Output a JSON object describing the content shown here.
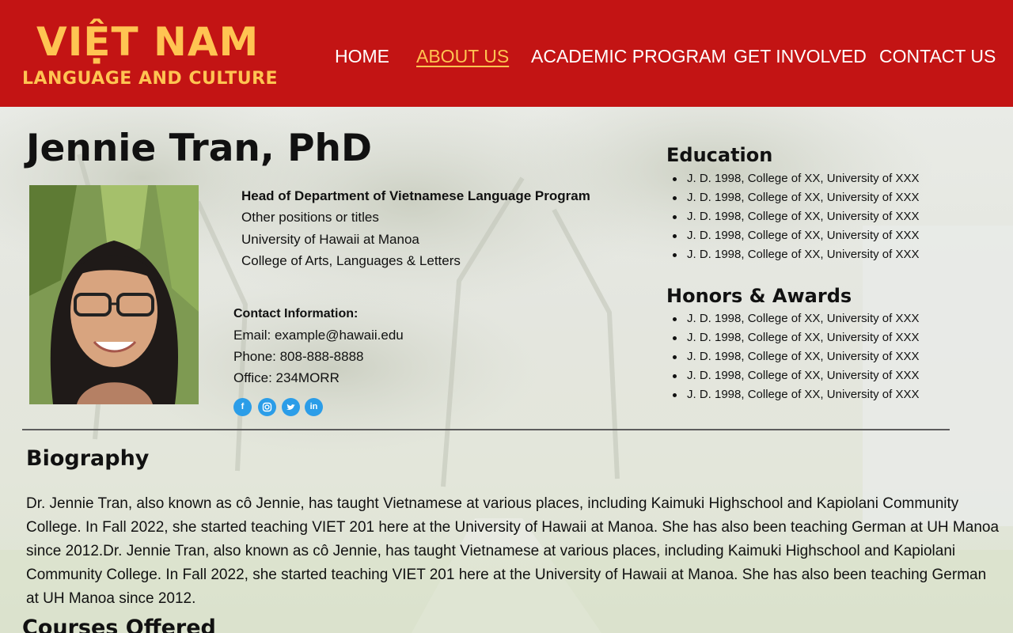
{
  "header": {
    "logo_title": "VIỆT NAM",
    "logo_subtitle": "LANGUAGE AND CULTURE",
    "brand_color": "#c31414",
    "accent_color": "#ffc452",
    "nav": [
      {
        "label": "HOME",
        "active": false
      },
      {
        "label": "ABOUT US",
        "active": true
      },
      {
        "label": "ACADEMIC PROGRAM",
        "active": false
      },
      {
        "label": "GET INVOLVED",
        "active": false
      },
      {
        "label": "CONTACT US",
        "active": false
      }
    ]
  },
  "profile": {
    "name": "Jennie Tran, PhD",
    "roles": [
      "Head of Department of Vietnamese Language Program",
      "Other positions or titles",
      "University of Hawaii at Manoa",
      "College of Arts, Languages & Letters"
    ],
    "contact": {
      "heading": "Contact Information:",
      "email": "Email: example@hawaii.edu",
      "phone": "Phone: 808-888-8888",
      "office": "Office: 234MORR"
    },
    "social_icons": [
      "facebook-icon",
      "instagram-icon",
      "twitter-icon",
      "linkedin-icon"
    ]
  },
  "education": {
    "title": "Education",
    "items": [
      "J. D. 1998, College of XX, University of XXX",
      "J. D. 1998, College of XX, University of XXX",
      "J. D. 1998, College of XX, University of XXX",
      "J. D. 1998, College of XX, University of XXX",
      "J. D. 1998, College of XX, University of XXX"
    ]
  },
  "honors": {
    "title": "Honors & Awards",
    "items": [
      "J. D. 1998, College of XX, University of XXX",
      "J. D. 1998, College of XX, University of XXX",
      "J. D. 1998, College of XX, University of XXX",
      "J. D. 1998, College of XX, University of XXX",
      "J. D. 1998, College of XX, University of XXX"
    ]
  },
  "biography": {
    "title": "Biography",
    "text": "Dr. Jennie Tran, also known as cô Jennie, has taught Vietnamese at various places, including Kaimuki Highschool and Kapiolani Community College. In Fall 2022, she started teaching VIET 201 here at the University of Hawaii at Manoa. She has also been teaching German at UH Manoa since 2012.Dr. Jennie Tran, also known as cô Jennie, has taught Vietnamese at various places, including Kaimuki Highschool and Kapiolani Community College. In Fall 2022, she started teaching VIET 201 here at the University of Hawaii at Manoa. She has also been teaching German at UH Manoa since 2012."
  },
  "courses": {
    "title": "Courses Offered"
  }
}
